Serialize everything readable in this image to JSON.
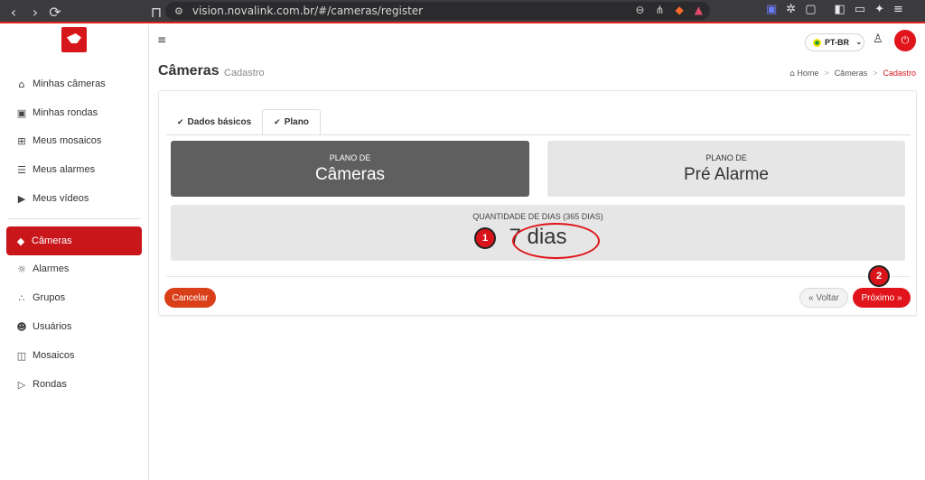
{
  "browser": {
    "url": "vision.novalink.com.br/#/cameras/register",
    "back_icon": "chevron-left-icon",
    "forward_icon": "chevron-right-icon",
    "reload_icon": "reload-icon"
  },
  "sidebar": {
    "items": [
      {
        "label": "Minhas câmeras",
        "icon": "home-icon"
      },
      {
        "label": "Minhas rondas",
        "icon": "play-square-icon"
      },
      {
        "label": "Meus mosaicos",
        "icon": "grid-icon"
      },
      {
        "label": "Meus alarmes",
        "icon": "alarm-icon"
      },
      {
        "label": "Meus vídeos",
        "icon": "play-circle-icon"
      },
      {
        "label": "Câmeras",
        "icon": "camera-icon"
      },
      {
        "label": "Alarmes",
        "icon": "siren-icon"
      },
      {
        "label": "Grupos",
        "icon": "group-icon"
      },
      {
        "label": "Usuários",
        "icon": "users-icon"
      },
      {
        "label": "Mosaicos",
        "icon": "mosaic-icon"
      },
      {
        "label": "Rondas",
        "icon": "patrol-icon"
      }
    ],
    "active_color": "#c8161b"
  },
  "header": {
    "language": "PT-BR"
  },
  "page": {
    "title": "Câmeras",
    "subtitle": "Cadastro",
    "breadcrumb": [
      "Home",
      "Câmeras",
      "Cadastro"
    ]
  },
  "tabs": [
    {
      "label": "Dados básicos",
      "active": false
    },
    {
      "label": "Plano",
      "active": true
    }
  ],
  "plans": {
    "cameras": {
      "label": "PLANO DE",
      "value": "Câmeras"
    },
    "pre_alarm": {
      "label": "PLANO DE",
      "value": "Pré Alarme"
    }
  },
  "days": {
    "label": "QUANTIDADE DE DIAS (365 DIAS)",
    "value": "7 dias"
  },
  "markers": [
    "1",
    "2"
  ],
  "buttons": {
    "cancel": "Cancelar",
    "back": "« Voltar",
    "next": "Próximo »"
  },
  "colors": {
    "accent": "#e0141a",
    "cancel": "#d9401a",
    "plan_selected": "#5f5f5f",
    "plan_unselected": "#e6e6e6"
  }
}
